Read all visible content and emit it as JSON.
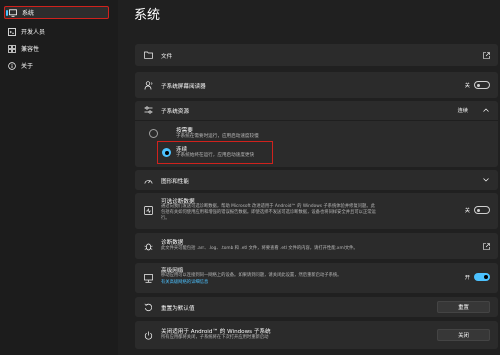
{
  "sidebar": {
    "items": [
      {
        "label": "系统",
        "icon": "monitor-icon",
        "selected": true
      },
      {
        "label": "开发人员",
        "icon": "developer-icon",
        "selected": false
      },
      {
        "label": "兼容性",
        "icon": "compatibility-icon",
        "selected": false
      },
      {
        "label": "关于",
        "icon": "info-icon",
        "selected": false
      }
    ]
  },
  "page": {
    "title": "系统"
  },
  "files": {
    "title": "文件",
    "icon": "folder-icon",
    "trailing_icon": "external-link-icon"
  },
  "screen_reader": {
    "title": "子系统屏幕阅读器",
    "state_label": "关",
    "icon": "screen-reader-icon"
  },
  "resources": {
    "title": "子系统资源",
    "value": "连续",
    "icon": "sliders-icon",
    "options": [
      {
        "title": "按需要",
        "desc": "子系统在需要时运行，应用启动速度较慢",
        "selected": false
      },
      {
        "title": "连续",
        "desc": "子系统始终在运行，应用启动速度更快",
        "selected": true
      }
    ]
  },
  "graphics": {
    "title": "图形和性能",
    "icon": "gauge-icon"
  },
  "diagnostics_optional": {
    "title": "可选诊断数据",
    "desc_line1": "通过向我们发送可选诊断数据，帮助 Microsoft 改进适用于 Android™ 的 Windows 子系统体验并修复问题。此",
    "desc_line2": "包括有关如何使用应用和增强的错误报告数据。即使选择不发送可选诊断数据，设备也将同样安全并且可以正常运",
    "desc_line3": "行。",
    "state_label": "关",
    "icon": "diagnostics-icon"
  },
  "diagnostic_data": {
    "title": "诊断数据",
    "desc": "此文件夹可能包括 .arr、.log、.tomb 和 .etl 文件，将要查看 .etl 文件的内容，请打开性能.xml文件。",
    "icon": "bug-icon",
    "trailing_icon": "external-link-icon"
  },
  "advanced_network": {
    "title": "高级网络",
    "desc": "移动应用可以连接到同一网络上的设备。如果请到问题，请关闭此设置，然后重新启动子系统。",
    "link": "有关高级网络的详细信息",
    "state_label": "开",
    "icon": "network-icon"
  },
  "reset": {
    "title": "重置为默认值",
    "button": "重置",
    "icon": "reset-icon"
  },
  "shutdown": {
    "title": "关闭适用于 Android™ 的 Windows 子系统",
    "desc": "所有应用都将关闭，子系统将在下次打开应用时重新启动",
    "button": "关闭",
    "icon": "power-icon"
  },
  "colors": {
    "accent": "#4cc2ff",
    "highlight": "#d0221d",
    "card": "#2b2b2b",
    "bg": "#202020"
  }
}
